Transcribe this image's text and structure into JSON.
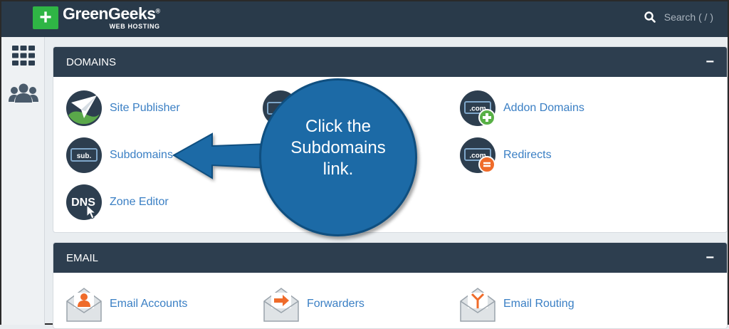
{
  "brand": {
    "name": "GreenGeeks",
    "tagline": "WEB HOSTING",
    "registered": "®"
  },
  "search": {
    "placeholder": "Search ( / )"
  },
  "sections": {
    "domains": {
      "title": "DOMAINS",
      "items": [
        {
          "label": "Site Publisher"
        },
        {
          "label": "Addon Domains"
        },
        {
          "label": "Subdomains"
        },
        {
          "label": "Redirects"
        },
        {
          "label": "Zone Editor"
        }
      ]
    },
    "email": {
      "title": "EMAIL",
      "items": [
        {
          "label": "Email Accounts"
        },
        {
          "label": "Forwarders"
        },
        {
          "label": "Email Routing"
        }
      ]
    }
  },
  "icons": {
    "com_text": ".com",
    "sub_text": "sub.",
    "dns_text": "DNS"
  },
  "callout": {
    "text": "Click the Subdomains link."
  },
  "colors": {
    "topbar": "#293a4a",
    "panel_header": "#2d3e4f",
    "link": "#3a7fc4",
    "brand_green": "#2fb545",
    "callout": "#1c6aa6",
    "email_orange": "#ef6b2a"
  }
}
